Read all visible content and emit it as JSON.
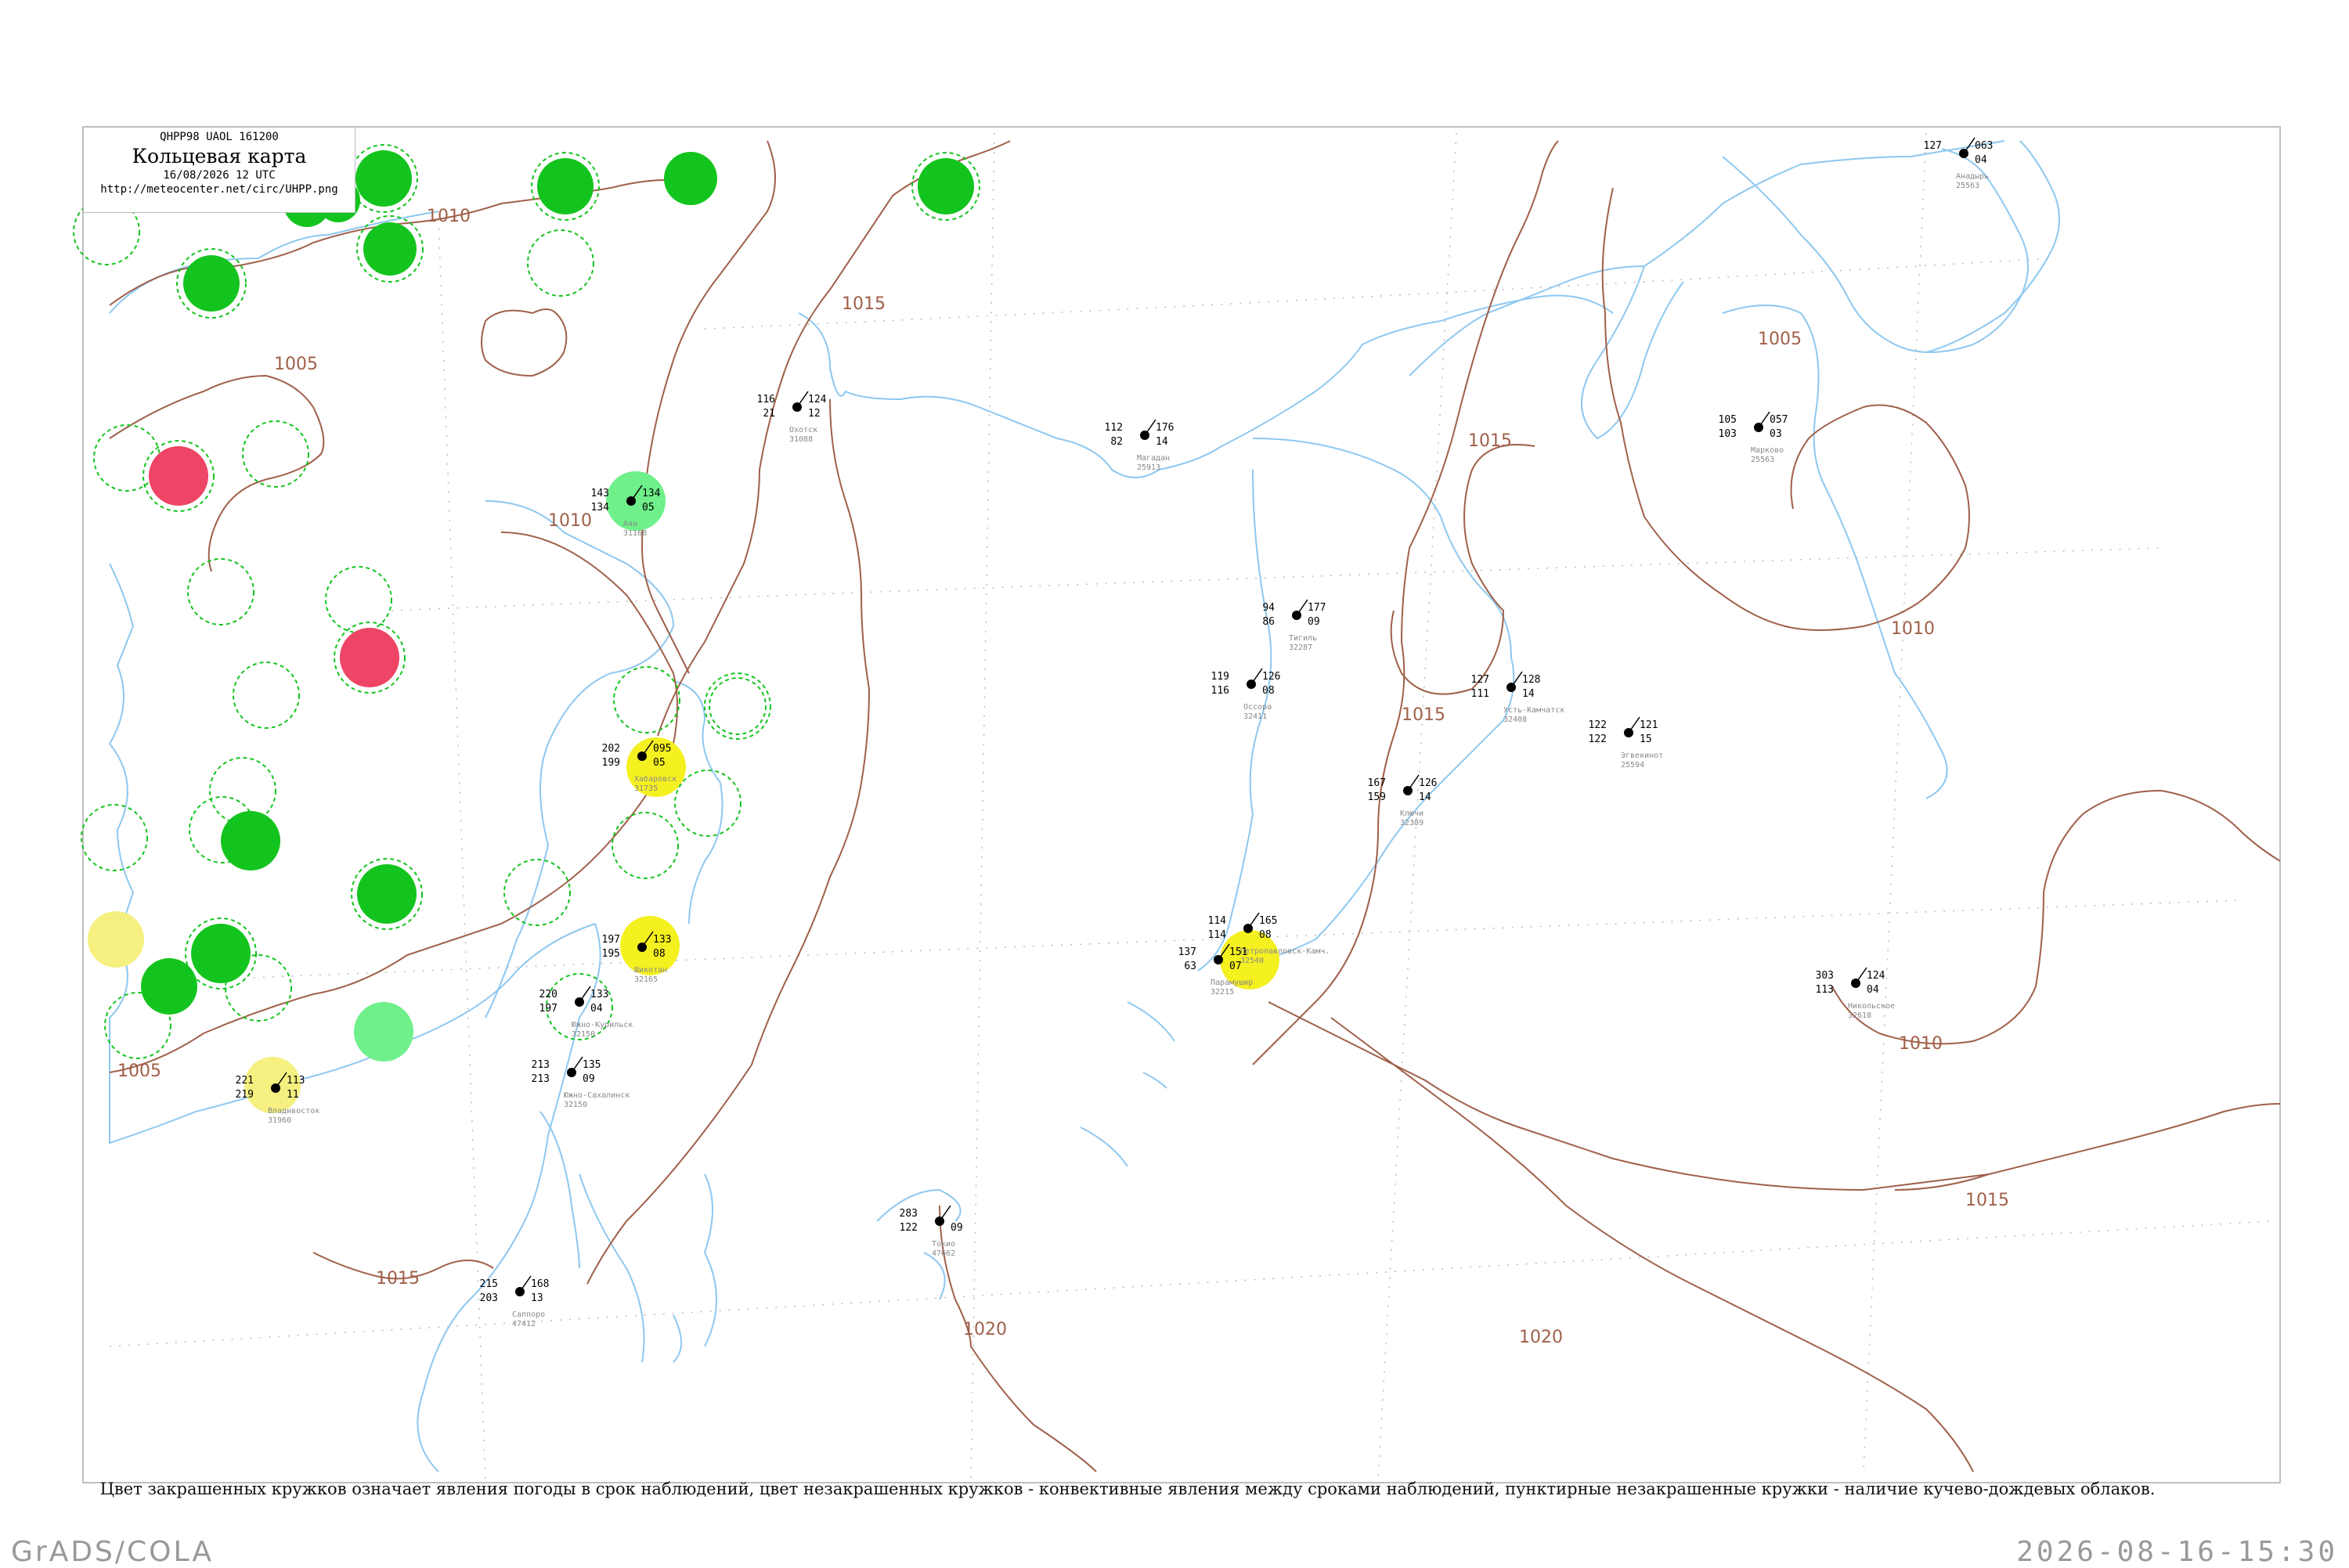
{
  "legend": {
    "code": "QHPP98  UAOL  161200",
    "title": "Кольцевая карта",
    "datetime": "16/08/2026 12 UTC",
    "url": "http://meteocenter.net/circ/UHPP.png"
  },
  "caption": "Цвет закрашенных кружков означает явления погоды в срок наблюдений, цвет незакрашенных кружков - конвективные явления между сроками наблюдений, пунктирные незакрашенные кружки - наличие кучево-дождевых облаков.",
  "footer": {
    "left": "GrADS/COLA",
    "right": "2026-08-16-15:30"
  },
  "colors": {
    "coast": "#8ec8f0",
    "isobar": "#a0604a",
    "green": "#14c41e",
    "lightgreen": "#6ff08a",
    "red": "#ee4466",
    "yellow": "#f5f020"
  },
  "isobar_labels": [
    "1010",
    "1005",
    "1010",
    "1015",
    "1005",
    "1015",
    "1005",
    "1015",
    "1010",
    "1010",
    "1015",
    "1015",
    "1020",
    "1020"
  ],
  "stations": [
    {
      "name": "Магадан",
      "id": "25913",
      "t": "112",
      "p": "176",
      "d": "82",
      "x2": "14"
    },
    {
      "name": "Охотск",
      "id": "31088",
      "t": "116",
      "p": "124",
      "d": "21",
      "x2": "12"
    },
    {
      "name": "Усть-Камчатск",
      "id": "32408",
      "t": "127",
      "p": "128",
      "d": "111",
      "x2": "14"
    },
    {
      "name": "Петропавловск-Камч.",
      "id": "32540",
      "t": "114",
      "p": "165",
      "d": "114",
      "x2": "08"
    },
    {
      "name": "Шикотан",
      "id": "32165",
      "t": "197",
      "p": "133",
      "d": "195",
      "x2": "08"
    },
    {
      "name": "Южно-Курильск",
      "id": "32150",
      "t": "220",
      "p": "133",
      "d": "197",
      "x2": "04"
    },
    {
      "name": "Парамушир",
      "id": "32215",
      "t": "137",
      "p": "151",
      "d": "63",
      "x2": "07"
    },
    {
      "name": "Никольское",
      "id": "32618",
      "t": "303",
      "p": "124",
      "d": "113",
      "x2": "04"
    },
    {
      "name": "Ключи",
      "id": "32389",
      "t": "167",
      "p": "126",
      "d": "159",
      "x2": "14"
    },
    {
      "name": "Тигиль",
      "id": "32287",
      "t": "94",
      "p": "177",
      "d": "86",
      "x2": "09"
    },
    {
      "name": "Оссора",
      "id": "32411",
      "t": "119",
      "p": "126",
      "d": "116",
      "x2": "08"
    },
    {
      "name": "Марково",
      "id": "25563",
      "t": "105",
      "p": "057",
      "d": "103",
      "x2": "03"
    },
    {
      "name": "Эгвекинот",
      "id": "25594",
      "t": "122",
      "p": "121",
      "d": "122",
      "x2": "15"
    },
    {
      "name": "Анадырь",
      "id": "25563",
      "t": "127",
      "p": "063",
      "d": "",
      "x2": "04"
    },
    {
      "name": "Южно-Сахалинск",
      "id": "32150",
      "t": "213",
      "p": "135",
      "d": "213",
      "x2": "09"
    },
    {
      "name": "Хабаровск",
      "id": "31735",
      "t": "202",
      "p": "095",
      "d": "199",
      "x2": "05"
    },
    {
      "name": "Владивосток",
      "id": "31960",
      "t": "221",
      "p": "113",
      "d": "219",
      "x2": "11"
    },
    {
      "name": "Аян",
      "id": "31168",
      "t": "143",
      "p": "134",
      "d": "134",
      "x2": "05"
    },
    {
      "name": "Токио",
      "id": "47662",
      "t": "283",
      "p": "",
      "d": "122",
      "x2": "09"
    },
    {
      "name": "Саппоро",
      "id": "47412",
      "t": "215",
      "p": "168",
      "d": "203",
      "x2": "13"
    }
  ]
}
